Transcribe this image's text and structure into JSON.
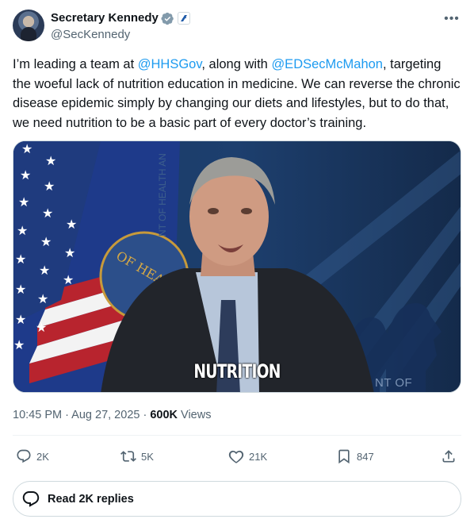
{
  "author": {
    "display_name": "Secretary Kennedy",
    "handle": "@SecKennedy"
  },
  "tweet": {
    "text_parts": [
      "I’m leading a team at ",
      "@HHSGov",
      ", along with ",
      "@EDSecMcMahon",
      ", targeting the woeful lack of nutrition education in medicine. We can reverse the chronic disease epidemic simply by changing our diets and lifestyles, but to do that, we need nutrition to be a basic part of every doctor’s training."
    ]
  },
  "media": {
    "caption": "NUTRITION",
    "wall_text": "NT OF HEALTH",
    "wall_text_vertical": "NT OF HEALTH AN",
    "seal_text": "OF HEA"
  },
  "meta": {
    "time": "10:45 PM",
    "separator": " · ",
    "date": "Aug 27, 2025",
    "separator2": " · ",
    "views_count": "600K",
    "views_label": " Views"
  },
  "actions": {
    "replies": "2K",
    "reposts": "5K",
    "likes": "21K",
    "bookmarks": "847"
  },
  "read_replies_label": "Read 2K replies",
  "colors": {
    "accent": "#1d9bf0",
    "secondary_text": "#536471",
    "border": "#cfd9de"
  },
  "icons": [
    "verified-badge-icon",
    "government-affiliation-icon",
    "more-icon",
    "reply-icon",
    "repost-icon",
    "like-icon",
    "bookmark-icon",
    "share-icon",
    "speech-bubble-icon"
  ]
}
